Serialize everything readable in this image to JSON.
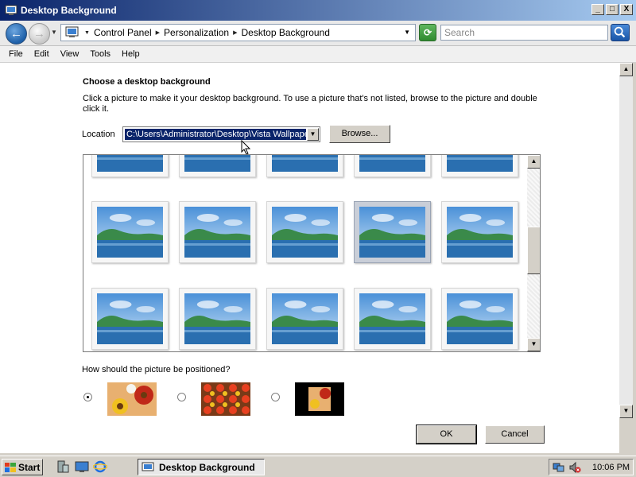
{
  "window": {
    "title": "Desktop Background",
    "minimize": "_",
    "maximize": "□",
    "close": "X"
  },
  "addressbar": {
    "crumbs": [
      "Control Panel",
      "Personalization",
      "Desktop Background"
    ],
    "search_placeholder": "Search"
  },
  "menubar": {
    "items": [
      "File",
      "Edit",
      "View",
      "Tools",
      "Help"
    ]
  },
  "content": {
    "heading": "Choose a desktop background",
    "description": "Click a picture to make it your desktop background. To use a picture that's not listed, browse to the picture and double click it.",
    "location_label": "Location",
    "location_value": "C:\\Users\\Administrator\\Desktop\\Vista Wallpapers",
    "browse_label": "Browse...",
    "position_question": "How should the picture be positioned?",
    "position_options": [
      {
        "name": "fit-to-screen",
        "selected": true
      },
      {
        "name": "tile",
        "selected": false
      },
      {
        "name": "center",
        "selected": false
      }
    ],
    "selected_thumbnail_index": 3
  },
  "buttons": {
    "ok": "OK",
    "cancel": "Cancel"
  },
  "taskbar": {
    "start_label": "Start",
    "task_label": "Desktop Background",
    "clock": "10:06 PM"
  },
  "colors": {
    "title_gradient_start": "#0a246a",
    "title_gradient_end": "#a6caf0",
    "selection": "#0a246a"
  }
}
